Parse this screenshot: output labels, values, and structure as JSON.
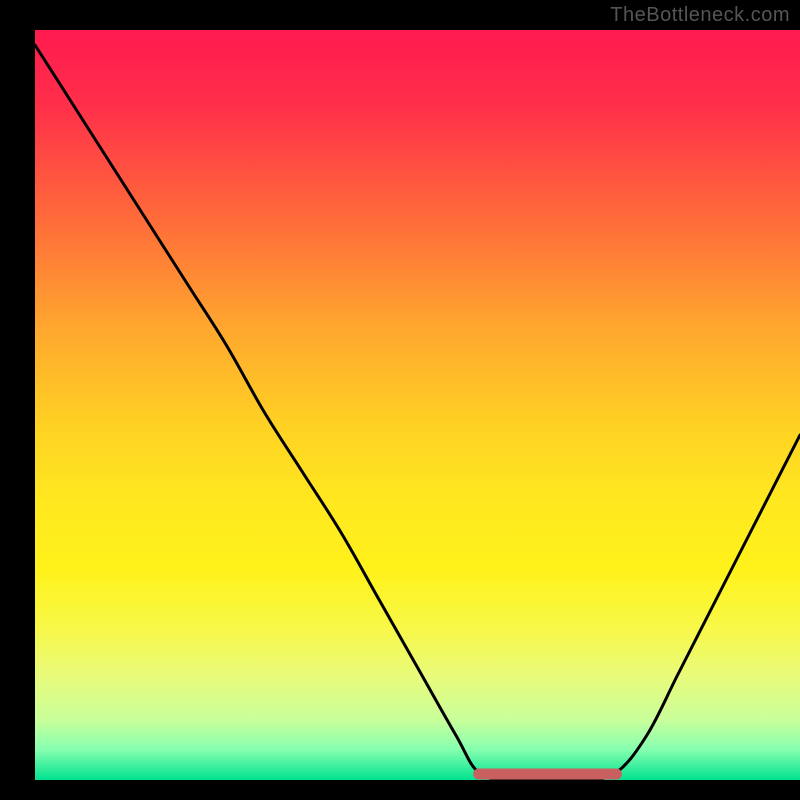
{
  "attribution": "TheBottleneck.com",
  "colors": {
    "background": "#000000",
    "attribution_text": "#555555",
    "curve_stroke": "#000000",
    "marker_fill": "#c86060",
    "gradient_stops": [
      "#ff1a4f",
      "#ff2f4a",
      "#ff6a3a",
      "#ffa82e",
      "#ffd223",
      "#ffe81f",
      "#fff21b",
      "#f7f84a",
      "#e9fb7a",
      "#c9ff9a",
      "#84ffb0",
      "#00e38f"
    ]
  },
  "chart_data": {
    "type": "line",
    "title": "",
    "xlabel": "",
    "ylabel": "",
    "xlim": [
      0,
      100
    ],
    "ylim": [
      0,
      100
    ],
    "grid": false,
    "categories_description": "x position (percent along horizontal axis)",
    "values_description": "bottleneck severity (percent; 0 = optimal, 100 = worst)",
    "x": [
      0,
      5,
      10,
      15,
      20,
      25,
      30,
      35,
      40,
      45,
      50,
      55,
      58,
      62,
      68,
      72,
      76,
      80,
      84,
      88,
      92,
      96,
      100
    ],
    "values": [
      98,
      90,
      82,
      74,
      66,
      58,
      49,
      41,
      33,
      24,
      15,
      6,
      1,
      0,
      0,
      0,
      1,
      6,
      14,
      22,
      30,
      38,
      46
    ],
    "optimal_band": {
      "x_start": 58,
      "x_end": 76,
      "y": 0
    },
    "annotations": []
  }
}
